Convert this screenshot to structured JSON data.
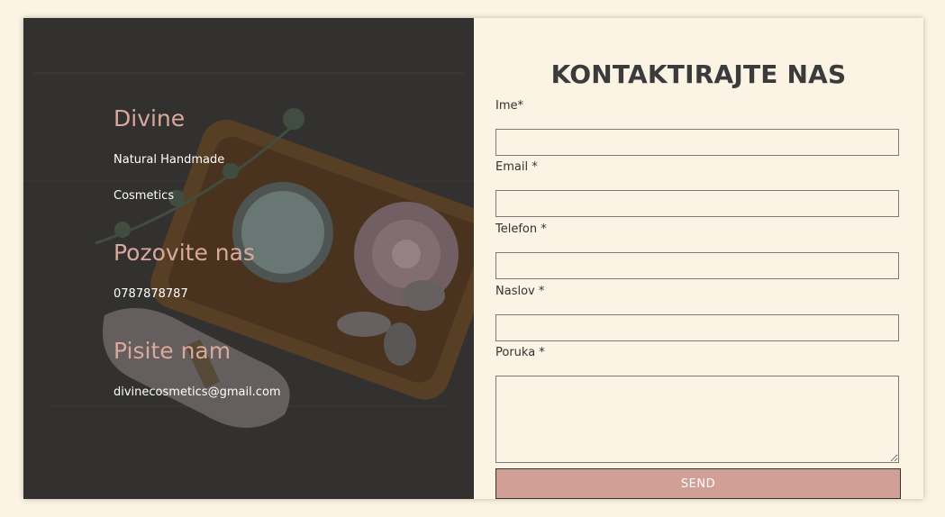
{
  "info": {
    "brand": "Divine",
    "tagline_1": "Natural Handmade",
    "tagline_2": "Cosmetics",
    "call_heading": "Pozovite nas",
    "phone": "0787878787",
    "write_heading": "Pisite nam",
    "email": "divinecosmetics@gmail.com"
  },
  "form": {
    "title": "KONTAKTIRAJTE NAS",
    "name_label": "Ime*",
    "email_label": "Email *",
    "phone_label": "Telefon *",
    "subject_label": "Naslov *",
    "message_label": "Poruka *",
    "send_label": "SEND"
  },
  "colors": {
    "page_bg": "#fbf3e3",
    "accent": "#d9a89b",
    "button": "#d19f96",
    "text_dark": "#3b3b3b"
  }
}
